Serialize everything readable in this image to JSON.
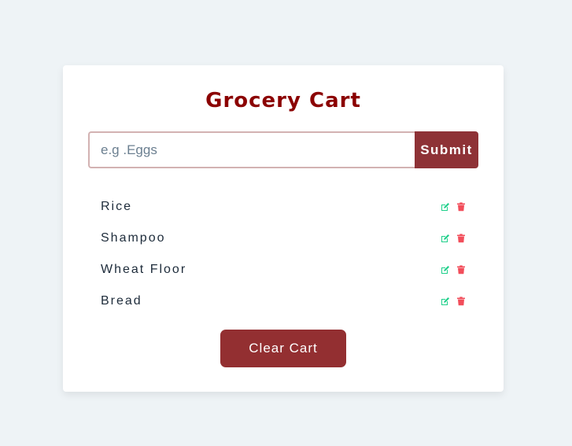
{
  "app": {
    "title": "Grocery Cart"
  },
  "form": {
    "input_value": "",
    "input_placeholder": "e.g .Eggs",
    "submit_label": "Submit"
  },
  "items": [
    {
      "name": "Rice",
      "edit_icon": "edit-icon",
      "delete_icon": "trash-icon"
    },
    {
      "name": "Shampoo",
      "edit_icon": "edit-icon",
      "delete_icon": "trash-icon"
    },
    {
      "name": "Wheat Floor",
      "edit_icon": "edit-icon",
      "delete_icon": "trash-icon"
    },
    {
      "name": "Bread",
      "edit_icon": "edit-icon",
      "delete_icon": "trash-icon"
    }
  ],
  "clear_button": {
    "label": "Clear Cart"
  },
  "colors": {
    "title": "#8b0000",
    "submit_bg": "#8e3236",
    "clear_bg": "#932f31",
    "edit_icon": "#1ecf8a",
    "delete_icon": "#f24d5a",
    "page_bg": "#eef3f6"
  }
}
